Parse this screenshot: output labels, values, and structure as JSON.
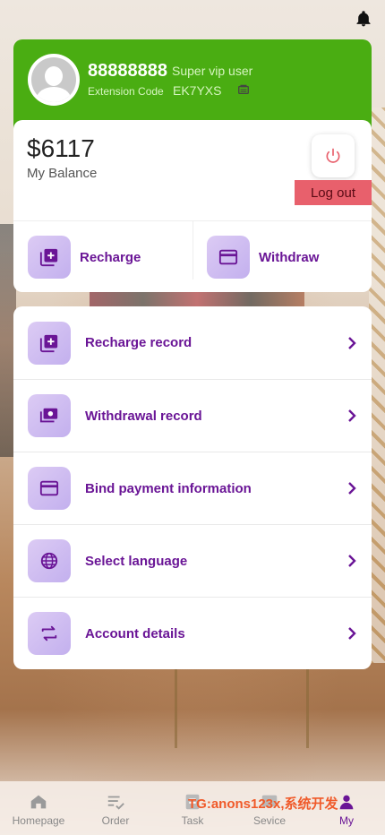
{
  "user": {
    "id": "88888888",
    "level": "Super vip user",
    "extension_label": "Extension Code",
    "extension_code": "EK7YXS"
  },
  "balance": {
    "amount": "$6117",
    "label": "My Balance",
    "logout_label": "Log out"
  },
  "actions": [
    {
      "label": "Recharge",
      "icon": "add-box-icon"
    },
    {
      "label": "Withdraw",
      "icon": "card-icon"
    }
  ],
  "menu": [
    {
      "label": "Recharge record",
      "icon": "add-box-icon"
    },
    {
      "label": "Withdrawal record",
      "icon": "money-icon"
    },
    {
      "label": "Bind payment information",
      "icon": "card-icon"
    },
    {
      "label": "Select language",
      "icon": "globe-icon"
    },
    {
      "label": "Account details",
      "icon": "swap-icon"
    }
  ],
  "nav": [
    {
      "label": "Homepage",
      "icon": "home-icon",
      "active": false
    },
    {
      "label": "Order",
      "icon": "order-icon",
      "active": false
    },
    {
      "label": "Task",
      "icon": "task-icon",
      "active": false
    },
    {
      "label": "Sevice",
      "icon": "service-icon",
      "active": false
    },
    {
      "label": "My",
      "icon": "user-icon",
      "active": true
    }
  ],
  "watermark": "TG:anons123x,系统开发",
  "colors": {
    "header_green": "#4aad12",
    "accent_purple": "#6a1596",
    "logout_red": "#e8606c",
    "icon_lilac": "#c3b0ee"
  }
}
